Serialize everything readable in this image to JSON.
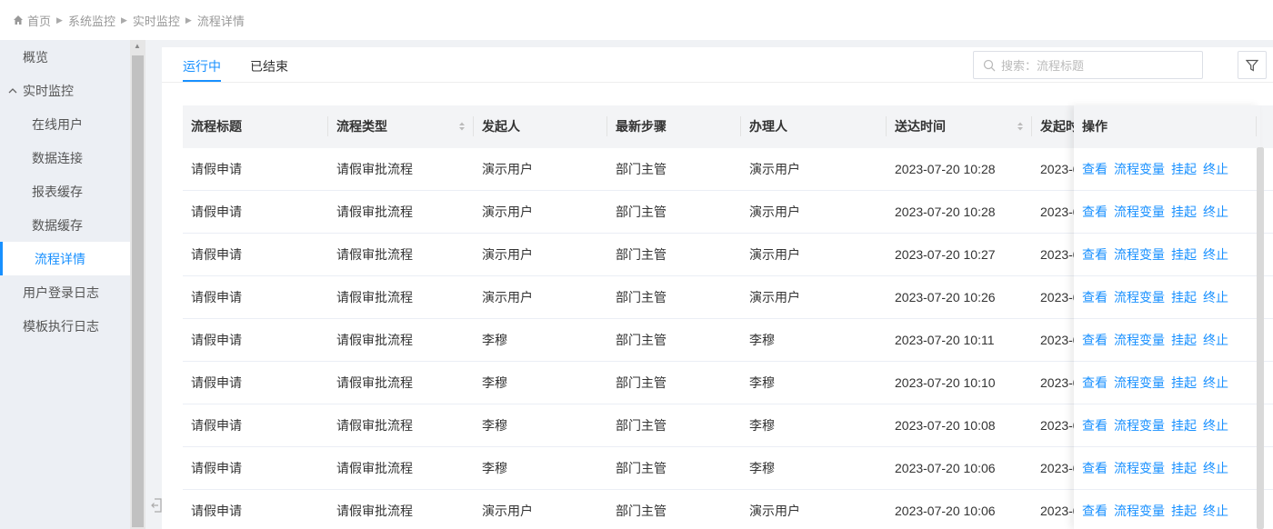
{
  "breadcrumb": {
    "items": [
      "首页",
      "系统监控",
      "实时监控",
      "流程详情"
    ]
  },
  "sidebar": {
    "items": [
      {
        "label": "概览"
      },
      {
        "label": "实时监控"
      },
      {
        "label": "在线用户"
      },
      {
        "label": "数据连接"
      },
      {
        "label": "报表缓存"
      },
      {
        "label": "数据缓存"
      },
      {
        "label": "流程详情"
      },
      {
        "label": "用户登录日志"
      },
      {
        "label": "模板执行日志"
      }
    ]
  },
  "tabs": [
    "运行中",
    "已结束"
  ],
  "search": {
    "placeholder": "搜索：流程标题"
  },
  "table": {
    "headers": [
      "流程标题",
      "流程类型",
      "发起人",
      "最新步骤",
      "办理人",
      "送达时间",
      "发起时",
      "操作"
    ],
    "rows": [
      [
        "请假申请",
        "请假审批流程",
        "演示用户",
        "部门主管",
        "演示用户",
        "2023-07-20 10:28",
        "2023-0"
      ],
      [
        "请假申请",
        "请假审批流程",
        "演示用户",
        "部门主管",
        "演示用户",
        "2023-07-20 10:28",
        "2023-0"
      ],
      [
        "请假申请",
        "请假审批流程",
        "演示用户",
        "部门主管",
        "演示用户",
        "2023-07-20 10:27",
        "2023-0"
      ],
      [
        "请假申请",
        "请假审批流程",
        "演示用户",
        "部门主管",
        "演示用户",
        "2023-07-20 10:26",
        "2023-0"
      ],
      [
        "请假申请",
        "请假审批流程",
        "李穆",
        "部门主管",
        "李穆",
        "2023-07-20 10:11",
        "2023-0"
      ],
      [
        "请假申请",
        "请假审批流程",
        "李穆",
        "部门主管",
        "李穆",
        "2023-07-20 10:10",
        "2023-0"
      ],
      [
        "请假申请",
        "请假审批流程",
        "李穆",
        "部门主管",
        "李穆",
        "2023-07-20 10:08",
        "2023-0"
      ],
      [
        "请假申请",
        "请假审批流程",
        "李穆",
        "部门主管",
        "李穆",
        "2023-07-20 10:06",
        "2023-0"
      ],
      [
        "请假申请",
        "请假审批流程",
        "演示用户",
        "部门主管",
        "演示用户",
        "2023-07-20 10:06",
        "2023-0"
      ]
    ],
    "actions": [
      "查看",
      "流程变量",
      "挂起",
      "终止"
    ]
  },
  "colors": {
    "accent": "#1890ff"
  }
}
